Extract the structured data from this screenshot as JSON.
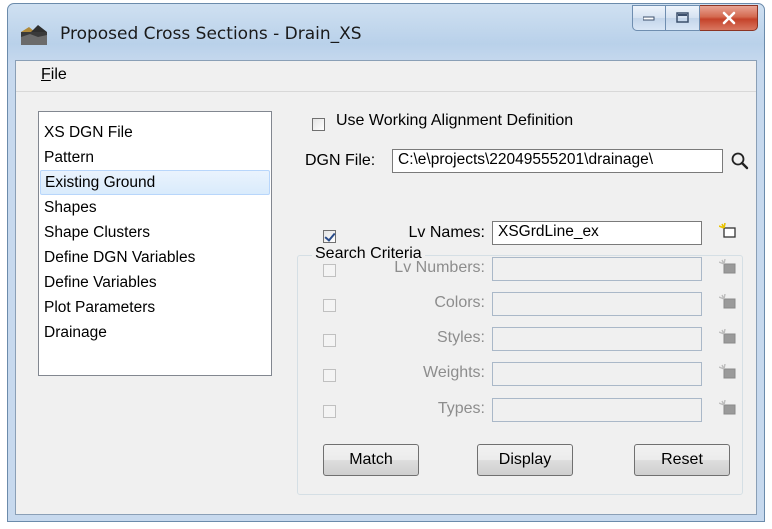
{
  "window": {
    "title": "Proposed Cross Sections - Drain_XS",
    "minimize": "minimize",
    "maximize": "maximize",
    "close": "close"
  },
  "menu": {
    "file": "File",
    "file_mnemonic": "F",
    "file_rest": "ile"
  },
  "nav": {
    "items": [
      "XS DGN File",
      "Pattern",
      "Existing Ground",
      "Shapes",
      "Shape Clusters",
      "Define DGN Variables",
      "Define Variables",
      "Plot Parameters",
      "Drainage"
    ],
    "selected": "Existing Ground"
  },
  "form": {
    "use_working_alignment": {
      "label": "Use Working Alignment Definition",
      "checked": false
    },
    "dgn_file": {
      "label": "DGN File:",
      "value": "C:\\e\\projects\\22049555201\\drainage\\"
    },
    "search_criteria": {
      "title": "Search Criteria",
      "rows": [
        {
          "label": "Lv Names:",
          "value": "XSGrdLine_ex",
          "checked": true,
          "enabled": true
        },
        {
          "label": "Lv Numbers:",
          "value": "",
          "checked": false,
          "enabled": false
        },
        {
          "label": "Colors:",
          "value": "",
          "checked": false,
          "enabled": false
        },
        {
          "label": "Styles:",
          "value": "",
          "checked": false,
          "enabled": false
        },
        {
          "label": "Weights:",
          "value": "",
          "checked": false,
          "enabled": false
        },
        {
          "label": "Types:",
          "value": "",
          "checked": false,
          "enabled": false
        }
      ]
    },
    "buttons": {
      "match": "Match",
      "display": "Display",
      "reset": "Reset"
    }
  },
  "icons": {
    "browse": "magnifier-icon",
    "pick": "element-pick-icon"
  }
}
